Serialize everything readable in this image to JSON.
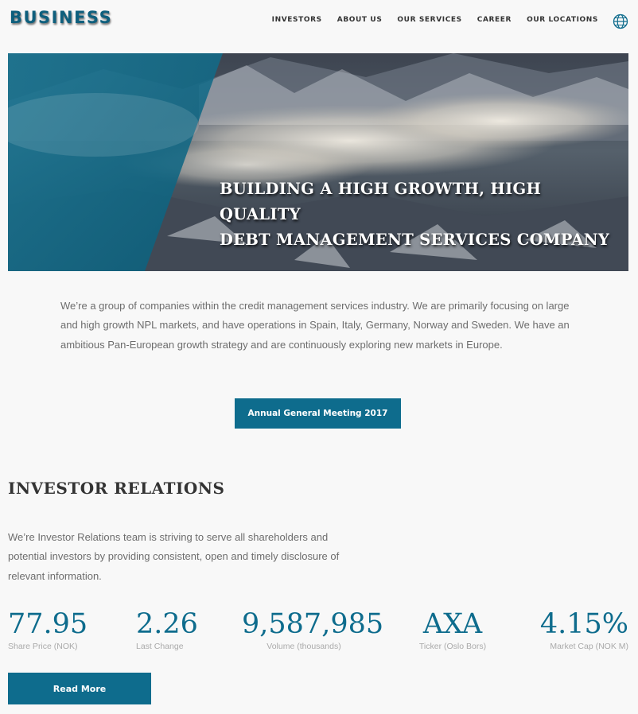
{
  "header": {
    "logo": "BUSINESS",
    "nav": [
      "INVESTORS",
      "ABOUT US",
      "OUR SERVICES",
      "CAREER",
      "OUR LOCATIONS"
    ],
    "language_icon": "globe-icon"
  },
  "hero": {
    "title_line1": "BUILDING A HIGH GROWTH, HIGH QUALITY",
    "title_line2": "DEBT MANAGEMENT SERVICES COMPANY"
  },
  "intro": {
    "text": "We’re a group of companies within the credit management services industry. We are primarily focusing on large and high growth NPL markets, and have operations in Spain, Italy, Germany, Norway and Sweden. We have an ambitious Pan-European growth strategy and are continuously exploring new markets in Europe.",
    "button": "Annual General Meeting 2017"
  },
  "investor_relations": {
    "title": "INVESTOR RELATIONS",
    "text": "We’re Investor Relations team is striving to serve all shareholders and potential investors by providing consistent, open and timely disclosure of relevant information.",
    "stats": [
      {
        "value": "77.95",
        "label": "Share Price (NOK)"
      },
      {
        "value": "2.26",
        "label": "Last Change"
      },
      {
        "value": "9,587,985",
        "label": "Volume (thousands)"
      },
      {
        "value": "AXA",
        "label": "Ticker (Oslo Bors)"
      },
      {
        "value": "4.15%",
        "label": "Market Cap (NOK M)"
      }
    ],
    "button": "Read More"
  },
  "colors": {
    "accent": "#0e6c8d",
    "logo": "#0e5f7d",
    "background": "#f8f8f8"
  }
}
